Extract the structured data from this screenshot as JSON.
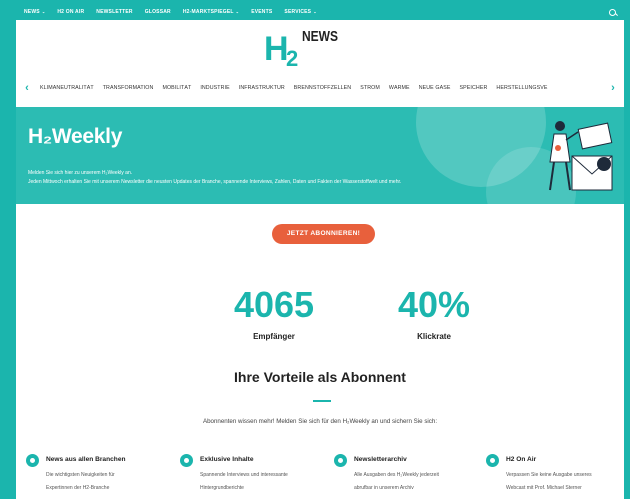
{
  "topnav": {
    "items": [
      {
        "label": "NEWS",
        "dropdown": true
      },
      {
        "label": "H2 ON AIR",
        "dropdown": false
      },
      {
        "label": "NEWSLETTER",
        "dropdown": false
      },
      {
        "label": "GLOSSAR",
        "dropdown": false
      },
      {
        "label": "H2-MARKTSPIEGEL",
        "dropdown": true
      },
      {
        "label": "EVENTS",
        "dropdown": false
      },
      {
        "label": "SERVICES",
        "dropdown": true
      }
    ],
    "search_icon": "search-icon"
  },
  "logo": {
    "h": "H",
    "two": "2",
    "news": "NEWS"
  },
  "categories": [
    "KLIMANEUTRALITÄT",
    "TRANSFORMATION",
    "MOBILITÄT",
    "INDUSTRIE",
    "INFRASTRUKTUR",
    "BRENNSTOFFZELLEN",
    "STROM",
    "WÄRME",
    "NEUE GASE",
    "SPEICHER",
    "HERSTELLUNGSVE"
  ],
  "hero": {
    "title": "H₂Weekly",
    "line1": "Melden Sie sich hier zu unserem H₂Weekly an.",
    "line2": "Jeden Mittwoch erhalten Sie mit unserem Newsletter die neusten Updates der Branche, spannende Interviews, Zahlen, Daten und Fakten der Wasserstoffwelt und mehr."
  },
  "cta": {
    "label": "JETZT ABONNIEREN!"
  },
  "stats": [
    {
      "value": "4065",
      "label": "Empfänger"
    },
    {
      "value": "40%",
      "label": "Klickrate"
    }
  ],
  "benefits": {
    "title": "Ihre Vorteile als Abonnent",
    "subtitle": "Abonnenten wissen mehr! Melden Sie sich für den H₂Weekly an und sichern Sie sich:",
    "features": [
      {
        "title": "News aus allen Branchen",
        "d1": "Die wichtigsten Neuigkeiten für",
        "d2": "Expertinnen der H2-Branche",
        "icon": "drop-icon"
      },
      {
        "title": "Exklusive Inhalte",
        "d1": "Spannende Interviews und interessante",
        "d2": "Hintergrundberichte",
        "icon": "star-icon"
      },
      {
        "title": "Newsletterarchiv",
        "d1": "Alle Ausgaben des H₂Weekly jederzeit",
        "d2": "abrufbar in unserem Archiv",
        "icon": "archive-icon"
      },
      {
        "title": "H2 On Air",
        "d1": "Verpassen Sie keine Ausgabe unseres",
        "d2": "Webcast mit Prof. Michael Sterner",
        "icon": "mic-icon"
      }
    ]
  },
  "colors": {
    "accent": "#1bb5ad",
    "cta": "#e8603c"
  }
}
